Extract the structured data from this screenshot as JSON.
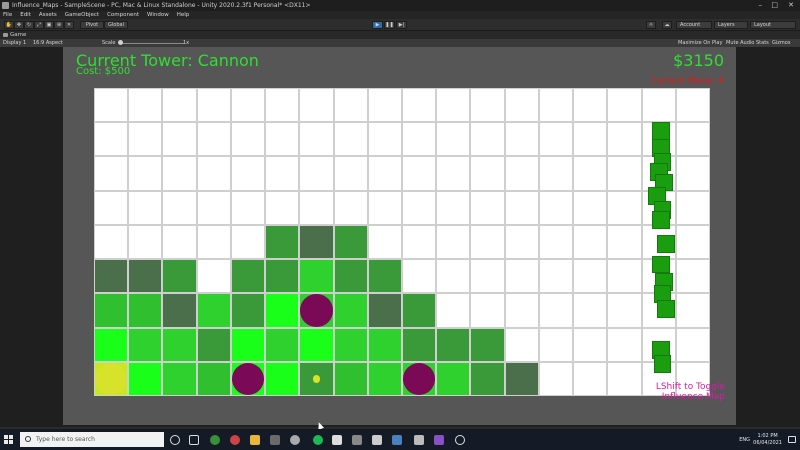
{
  "window": {
    "title": "Influence_Maps - SampleScene - PC, Mac & Linux Standalone - Unity 2020.2.3f1 Personal* <DX11>",
    "controls": [
      "–",
      "□",
      "✕"
    ]
  },
  "menu": [
    "File",
    "Edit",
    "Assets",
    "GameObject",
    "Component",
    "Window",
    "Help"
  ],
  "toolbar": {
    "pivot": "Pivot",
    "global": "Global",
    "account": "Account",
    "layers": "Layers",
    "layout": "Layout"
  },
  "game_tab": {
    "label": "Game",
    "display": "Display 1",
    "aspect": "16:9 Aspect",
    "scale_label": "Scale",
    "scale_value": "1x",
    "maximize": "Maximize On Play",
    "mute": "Mute Audio",
    "stats": "Stats",
    "gizmos": "Gizmos"
  },
  "hud": {
    "tower_title": "Current Tower: Cannon",
    "tower_cost": "Cost: $500",
    "money": "$3150",
    "wave": "Current Wave: 4",
    "toggle_line1": "LShift to Toggle",
    "toggle_line2": "Influence Map"
  },
  "grid": {
    "cols": 18,
    "rows": 9,
    "colors": {
      "W": "#ffffff",
      "D": "#4b6e4b",
      "M": "#3a9a3a",
      "G": "#2fd12f",
      "B": "#1aff1a",
      "S": "#2fbf2f",
      "Y": "#c7e81a"
    },
    "rows_map": [
      "WWWWWWWWWWWWWWWWWW",
      "WWWWWWWWWWWWWWWWWW",
      "WWWWWWWWWWWWWWWWWW",
      "WWWWWWWWWWWWWWWWWW",
      "WWWWWMDMWWWWWWWWWW",
      "DDMWMMGMMWWWWWWWWW",
      "SSDGMBGGDMWWWWWWWW",
      "BGGMBGBGGMMMWWWWWW",
      "YBGSBBMSGGGMDWWWWW"
    ],
    "towers": [
      {
        "col": 6,
        "row": 6
      },
      {
        "col": 4,
        "row": 8
      },
      {
        "col": 9,
        "row": 8
      }
    ],
    "targets": [
      {
        "col": 0,
        "row": 8,
        "size": "large"
      },
      {
        "col": 6,
        "row": 8,
        "size": "small"
      }
    ],
    "enemies": [
      {
        "col": 16.3,
        "row": 1.0
      },
      {
        "col": 16.3,
        "row": 1.5
      },
      {
        "col": 16.35,
        "row": 1.9
      },
      {
        "col": 16.25,
        "row": 2.2
      },
      {
        "col": 16.4,
        "row": 2.5
      },
      {
        "col": 16.2,
        "row": 2.9
      },
      {
        "col": 16.35,
        "row": 3.3
      },
      {
        "col": 16.3,
        "row": 3.6
      },
      {
        "col": 16.45,
        "row": 4.3
      },
      {
        "col": 16.3,
        "row": 4.9
      },
      {
        "col": 16.4,
        "row": 5.4
      },
      {
        "col": 16.35,
        "row": 5.75
      },
      {
        "col": 16.45,
        "row": 6.2
      },
      {
        "col": 16.3,
        "row": 7.4
      },
      {
        "col": 16.35,
        "row": 7.8
      }
    ]
  },
  "taskbar": {
    "search_placeholder": "Type here to search",
    "language": "ENG",
    "time": "1:02 PM",
    "date": "06/04/2021"
  }
}
